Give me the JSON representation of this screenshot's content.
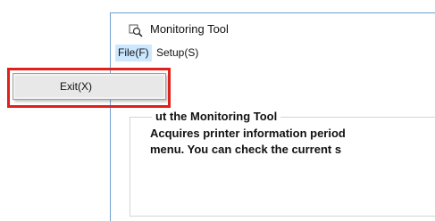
{
  "window": {
    "title": "Monitoring Tool",
    "title_icon": "magnifier-icon"
  },
  "menubar": {
    "file_label": "File(F)",
    "setup_label": "Setup(S)"
  },
  "file_menu": {
    "items": [
      {
        "label": "Exit(X)"
      }
    ]
  },
  "about_group": {
    "heading": "ut the Monitoring Tool",
    "lines": [
      "Acquires printer information period",
      "menu. You can check the current s"
    ]
  },
  "annotation": {
    "highlight_color": "#e0201a"
  }
}
